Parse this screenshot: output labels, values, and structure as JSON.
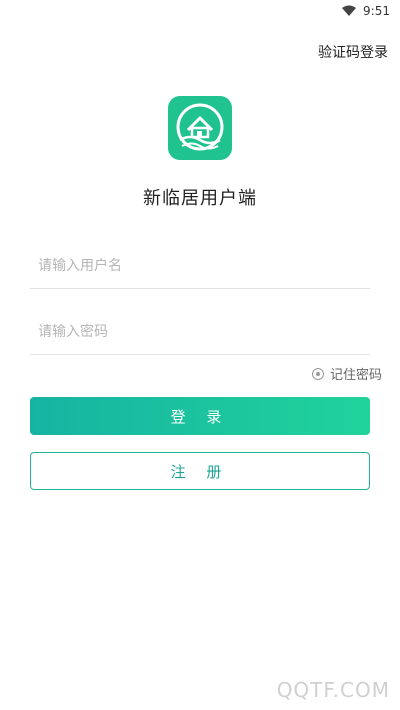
{
  "status_bar": {
    "time": "9:51",
    "wifi_icon": "wifi-icon"
  },
  "top_link": {
    "label": "验证码登录"
  },
  "logo": {
    "icon": "house-logo-icon",
    "color": "#20c28f"
  },
  "app_title": "新临居用户端",
  "form": {
    "username_placeholder": "请输入用户名",
    "username_value": "",
    "password_placeholder": "请输入密码",
    "password_value": "",
    "remember_label": "记住密码",
    "remember_checked": false
  },
  "buttons": {
    "login_label": "登 录",
    "register_label": "注 册"
  },
  "watermark": "QQTF.COM",
  "colors": {
    "accent_start": "#16b3a2",
    "accent_end": "#20d39b",
    "register_border": "#1db39c"
  }
}
